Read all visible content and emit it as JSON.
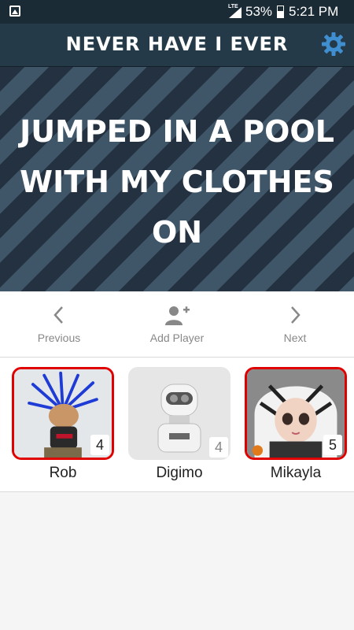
{
  "status_bar": {
    "network": "LTE",
    "battery": "53%",
    "time": "5:21 PM"
  },
  "app_bar": {
    "title": "NEVER HAVE I EVER",
    "settings_icon": "gear-icon"
  },
  "question": {
    "text": "JUMPED IN A POOL WITH MY CLOTHES ON"
  },
  "controls": {
    "previous_label": "Previous",
    "add_player_label": "Add Player",
    "next_label": "Next"
  },
  "players": [
    {
      "name": "Rob",
      "score": "4",
      "selected": true
    },
    {
      "name": "Digimo",
      "score": "4",
      "selected": false
    },
    {
      "name": "Mikayla",
      "score": "5",
      "selected": true
    }
  ],
  "colors": {
    "accent": "#3f8fd0",
    "selection": "#e00000",
    "header": "#253a48"
  }
}
